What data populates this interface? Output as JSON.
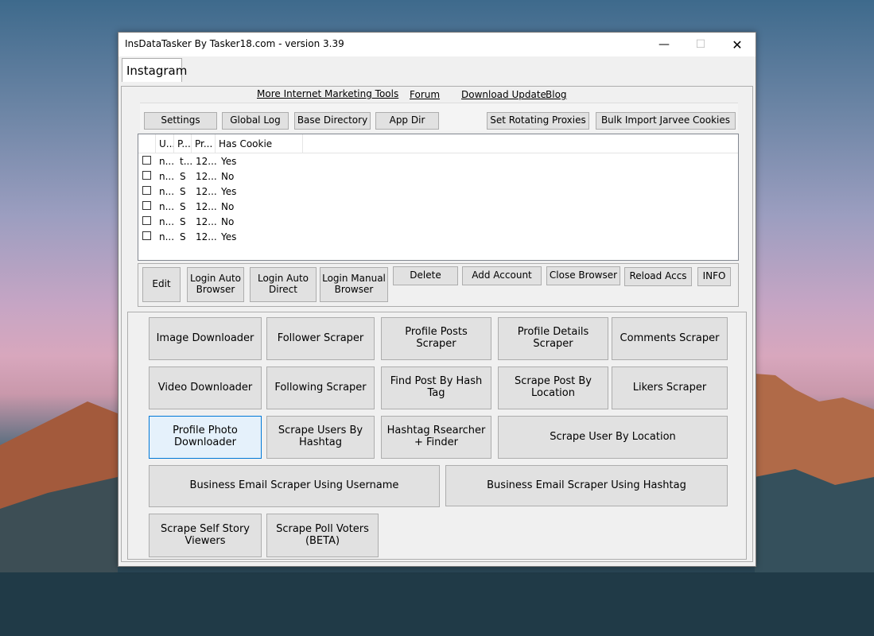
{
  "window": {
    "title": "InsDataTasker By Tasker18.com - version 3.39",
    "minimize_glyph": "—",
    "maximize_glyph": "☐",
    "close_glyph": "✕"
  },
  "tab": {
    "label": "Instagram"
  },
  "links": {
    "marketing": "More Internet Marketing Tools",
    "forum": "Forum",
    "download": "Download Update",
    "blog": "Blog"
  },
  "toolbar": {
    "settings": "Settings",
    "global_log": "Global Log",
    "base_directory": "Base Directory",
    "app_dir": "App Dir",
    "rotating_proxies": "Set Rotating Proxies",
    "bulk_import": "Bulk Import Jarvee Cookies"
  },
  "accounts": {
    "columns": [
      "U...",
      "P...",
      "Pr...",
      "Has Cookie"
    ],
    "rows": [
      {
        "u": "n...",
        "p": "t...",
        "pr": "12...",
        "cookie": "Yes"
      },
      {
        "u": "n...",
        "p": "S",
        "pr": "12...",
        "cookie": "No"
      },
      {
        "u": "n...",
        "p": "S",
        "pr": "12...",
        "cookie": "Yes"
      },
      {
        "u": "n...",
        "p": "S",
        "pr": "12...",
        "cookie": "No"
      },
      {
        "u": "n...",
        "p": "S",
        "pr": "12...",
        "cookie": "No"
      },
      {
        "u": "n...",
        "p": "S",
        "pr": "12...",
        "cookie": "Yes"
      }
    ]
  },
  "account_actions": {
    "edit": "Edit",
    "login_auto_browser": "Login Auto Browser",
    "login_auto_direct": "Login Auto Direct",
    "login_manual_browser": "Login Manual Browser",
    "delete": "Delete",
    "add_account": "Add Account",
    "close_browser": "Close Browser",
    "reload_accs": "Reload Accs",
    "info": "INFO"
  },
  "tools": {
    "image_downloader": "Image Downloader",
    "follower_scraper": "Follower Scraper",
    "profile_posts_scraper": "Profile Posts Scraper",
    "profile_details_scraper": "Profile Details Scraper",
    "comments_scraper": "Comments Scraper",
    "video_downloader": "Video Downloader",
    "following_scraper": "Following Scraper",
    "find_post_by_hash_tag": "Find Post By Hash Tag",
    "scrape_post_by_location": "Scrape Post By Location",
    "likers_scraper": "Likers Scraper",
    "profile_photo_downloader": "Profile Photo Downloader",
    "scrape_users_by_hashtag": "Scrape Users By Hashtag",
    "hashtag_researcher": "Hashtag Rsearcher + Finder",
    "scrape_user_by_location": "Scrape User By Location",
    "business_email_username": "Business Email Scraper Using Username",
    "business_email_hashtag": "Business Email Scraper Using Hashtag",
    "scrape_self_story_viewers": "Scrape Self Story Viewers",
    "scrape_poll_voters": "Scrape Poll Voters (BETA)"
  }
}
